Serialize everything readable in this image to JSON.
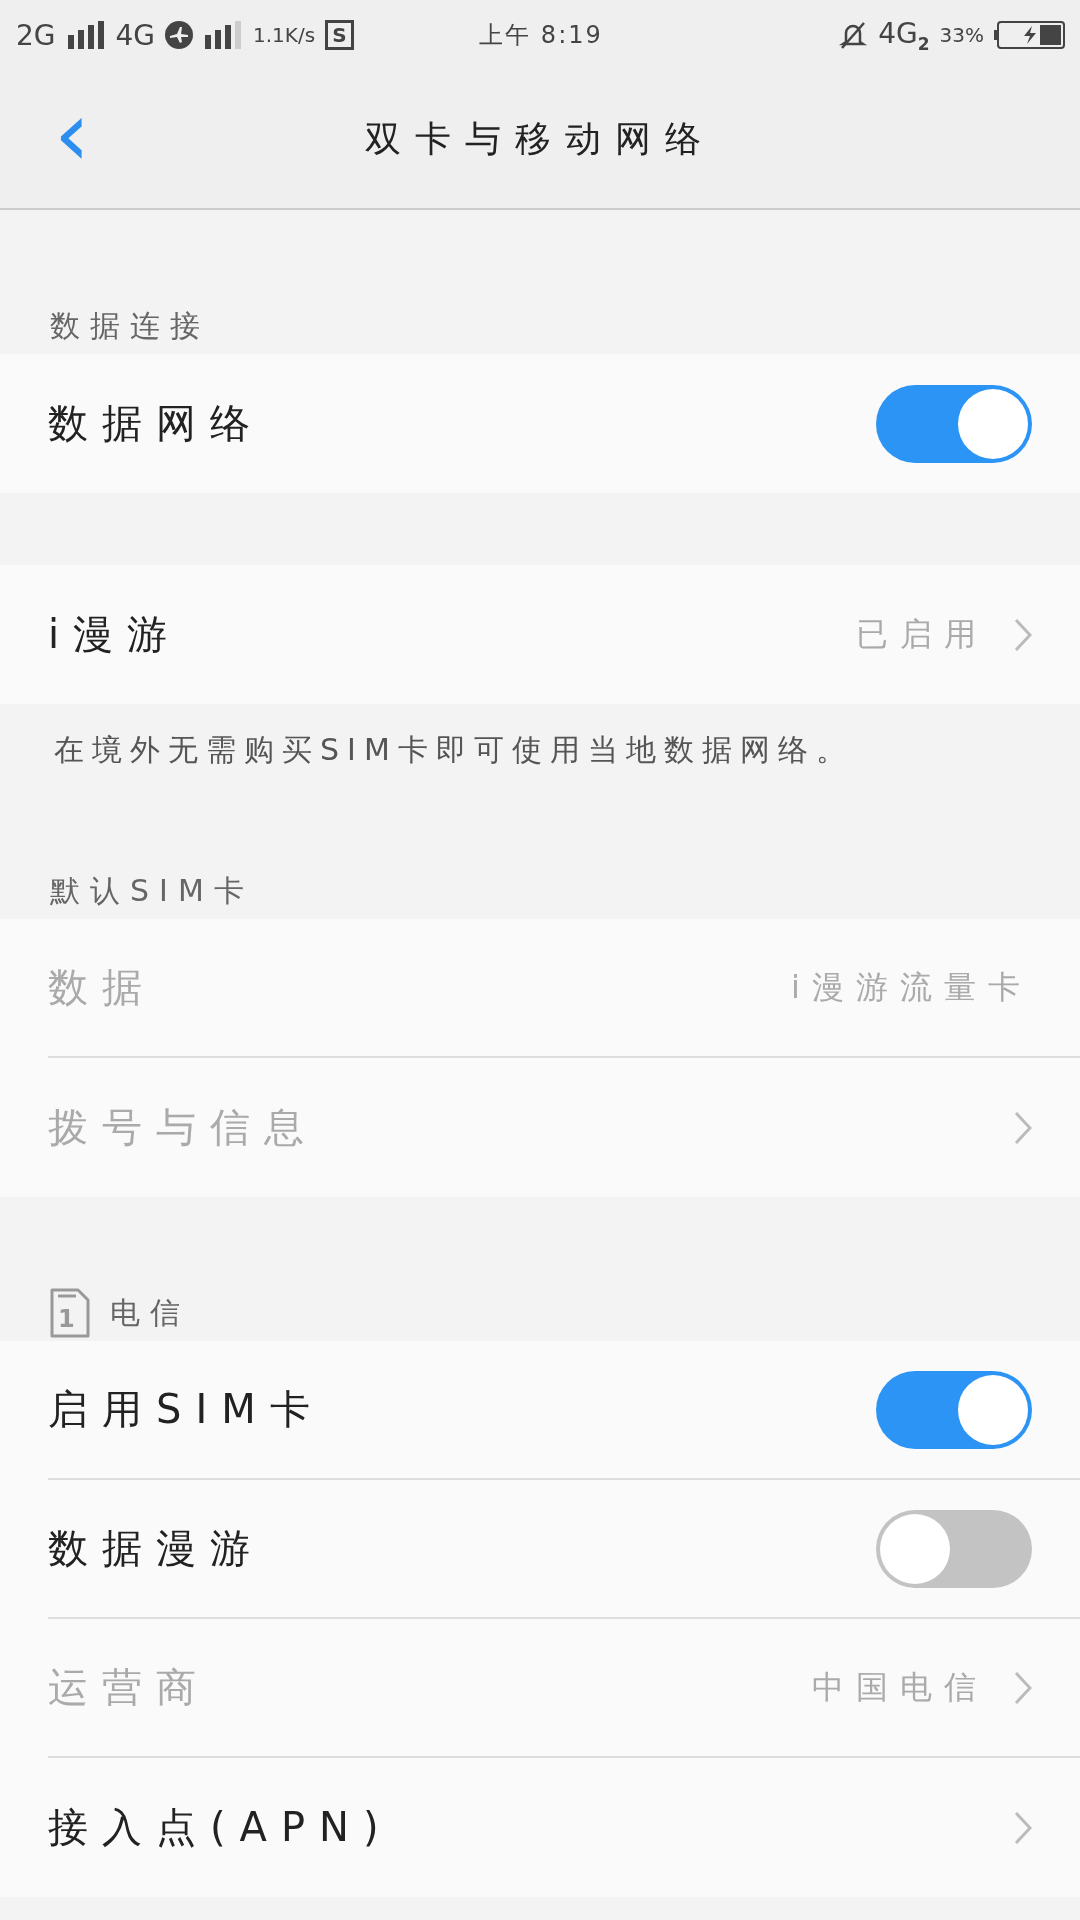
{
  "status_bar": {
    "sim1_network": "2G",
    "sim2_network": "4G",
    "speed": "1.1K/s",
    "badge": "S",
    "time": "上午 8:19",
    "data_network": "4G",
    "data_sim": "2",
    "battery": "33%"
  },
  "header": {
    "back": "‹",
    "title": "双卡与移动网络"
  },
  "sections": [
    {
      "header": "数据连接",
      "items": [
        {
          "kind": "toggle",
          "label": "数据网络",
          "on": true,
          "disabled": false
        }
      ]
    },
    {
      "items": [
        {
          "kind": "link",
          "label": "i漫游",
          "value": "已启用",
          "disabled": false
        }
      ],
      "note": "在境外无需购买SIM卡即可使用当地数据网络。"
    },
    {
      "header": "默认SIM卡",
      "items": [
        {
          "kind": "value",
          "label": "数据",
          "value": "i漫游流量卡",
          "disabled": true
        },
        {
          "kind": "link",
          "label": "拨号与信息",
          "disabled": true
        }
      ]
    },
    {
      "header": "电信",
      "sim_number": "1",
      "items": [
        {
          "kind": "toggle",
          "label": "启用SIM卡",
          "on": true,
          "disabled": false
        },
        {
          "kind": "toggle",
          "label": "数据漫游",
          "on": false,
          "disabled": false
        },
        {
          "kind": "link",
          "label": "运营商",
          "value": "中国电信",
          "disabled": true
        },
        {
          "kind": "link",
          "label": "接入点(APN)",
          "disabled": false
        }
      ]
    }
  ]
}
